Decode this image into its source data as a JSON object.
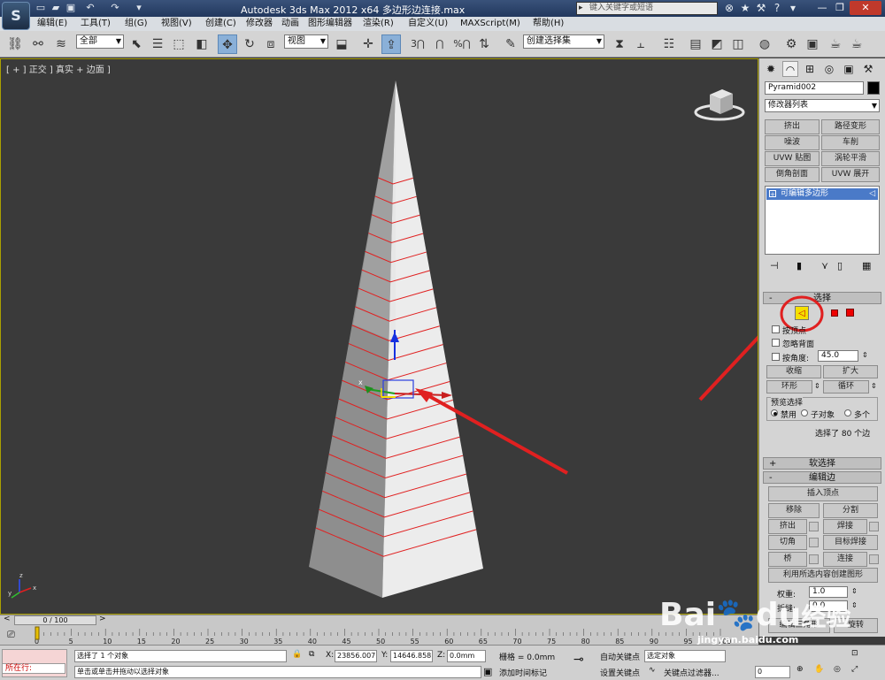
{
  "titlebar": {
    "app_logo": "S",
    "title": "Autodesk 3ds Max  2012 x64      多边形边连接.max",
    "search_placeholder": "键入关键字或短语"
  },
  "menu": [
    "编辑(E)",
    "工具(T)",
    "组(G)",
    "视图(V)",
    "创建(C)",
    "修改器",
    "动画",
    "图形编辑器",
    "渲染(R)",
    "自定义(U)",
    "MAXScript(M)",
    "帮助(H)"
  ],
  "toolbar": {
    "selection_filter": "全部",
    "reference_coord": "视图",
    "named_selection": "创建选择集",
    "snap_labels": [
      "3",
      "2.5",
      "%"
    ]
  },
  "viewport": {
    "label": "[ + ] 正交 ] 真实 + 边面 ]",
    "axis_labels": {
      "z": "z",
      "x": "x",
      "y": "y"
    },
    "section_line_count": 20,
    "annotation_color": "#e02020",
    "accent_color": "#f5e000"
  },
  "cmdpanel": {
    "object_name": "Pyramid002",
    "object_color": "#000000",
    "modifier_list": "修改器列表",
    "modifier_buttons": [
      "挤出",
      "路径变形",
      "噪波",
      "车削",
      "UVW 贴图",
      "涡轮平滑",
      "倒角剖面",
      "UVW 展开"
    ],
    "stack_item": "可编辑多边形",
    "select_rollout": {
      "title": "选择",
      "by_vertex": "按顶点",
      "ignore_backfacing": "忽略背面",
      "by_angle": "按角度:",
      "angle_value": "45.0",
      "shrink": "收缩",
      "grow": "扩大",
      "ring": "环形",
      "loop": "循环",
      "preview_title": "预览选择",
      "preview_options": [
        "禁用",
        "子对象",
        "多个"
      ],
      "selected_info": "选择了 80 个边"
    },
    "soft_select_title": "软选择",
    "edit_edges": {
      "title": "编辑边",
      "insert_vertex": "插入顶点",
      "remove": "移除",
      "split": "分割",
      "extrude": "挤出",
      "weld": "焊接",
      "chamfer": "切角",
      "target_weld": "目标焊接",
      "bridge": "桥",
      "connect": "连接",
      "create_shape": "利用所选内容创建图形",
      "weight_label": "权重:",
      "weight_value": "1.0",
      "crease_label": "折缝:",
      "crease_value": "0.0",
      "edit_tri": "编辑三角形",
      "turn": "旋转"
    }
  },
  "timeline": {
    "frame_counter": "0 / 100",
    "ticks": [
      "0",
      "5",
      "10",
      "15",
      "20",
      "25",
      "30",
      "35",
      "40",
      "45",
      "50",
      "55",
      "60",
      "65",
      "70",
      "75",
      "80",
      "85",
      "90",
      "95",
      "100"
    ]
  },
  "status": {
    "running_label": "所在行:",
    "selection_msg": "选择了 1 个对象",
    "prompt_msg": "单击或单击并拖动以选择对象",
    "x_label": "X:",
    "x_value": "23856.007",
    "y_label": "Y:",
    "y_value": "14646.858",
    "z_label": "Z:",
    "z_value": "0.0mm",
    "grid": "栅格 = 0.0mm",
    "add_time_tag": "添加时间标记",
    "auto_key": "自动关键点",
    "selected_set": "选定对象",
    "set_key": "设置关键点",
    "key_filters": "关键点过滤器...",
    "frame_value": "0"
  },
  "watermark": {
    "brand": "Bai",
    "brand2": "du",
    "brand_cn": "经验",
    "url": "jingyan.baidu.com"
  }
}
